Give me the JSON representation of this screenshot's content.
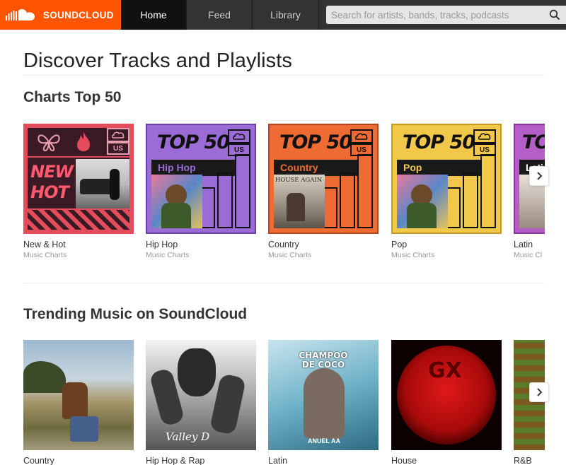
{
  "brand": {
    "name": "SOUNDCLOUD",
    "color": "#ff5500"
  },
  "nav": {
    "home": "Home",
    "feed": "Feed",
    "library": "Library"
  },
  "search": {
    "placeholder": "Search for artists, bands, tracks, podcasts",
    "icon": "search-icon"
  },
  "page_title": "Discover Tracks and Playlists",
  "charts": {
    "title": "Charts Top 50",
    "cards": [
      {
        "title": "New & Hot",
        "subtitle": "Music Charts",
        "art_line1": "NEW &",
        "art_line2": "HOT"
      },
      {
        "title": "Hip Hop",
        "subtitle": "Music Charts",
        "art_top": "TOP 50",
        "art_genre": "Hip Hop",
        "art_region": "US",
        "color": "#9b6cd6"
      },
      {
        "title": "Country",
        "subtitle": "Music Charts",
        "art_top": "TOP 50",
        "art_genre": "Country",
        "art_region": "US",
        "color": "#ee6b33",
        "art_cover_text": "HOUSE AGAIN"
      },
      {
        "title": "Pop",
        "subtitle": "Music Charts",
        "art_top": "TOP 50",
        "art_genre": "Pop",
        "art_region": "US",
        "color": "#f2c84b"
      },
      {
        "title": "Latin",
        "subtitle": "Music Cl",
        "art_top": "TO",
        "art_genre": "Lati",
        "color": "#b45fc8"
      }
    ]
  },
  "trending": {
    "title": "Trending Music on SoundCloud",
    "cards": [
      {
        "title": "Country"
      },
      {
        "title": "Hip Hop & Rap",
        "art_text": "Valley D"
      },
      {
        "title": "Latin",
        "art_text_top": "CHAMPOO DE COCO",
        "art_text_bottom": "ANUEL AA"
      },
      {
        "title": "House",
        "art_text": "GX"
      },
      {
        "title": "R&B"
      }
    ]
  }
}
